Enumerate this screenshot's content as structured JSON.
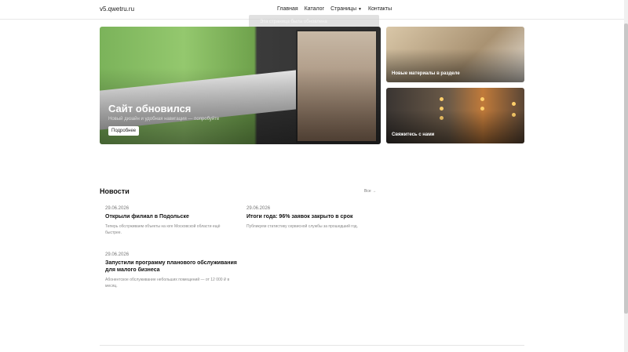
{
  "header": {
    "logo": "v5.qwetru.ru",
    "nav": [
      "Главная",
      "Каталог",
      "Страницы",
      "Контакты"
    ]
  },
  "toast": {
    "text": "Эта страница была обновлена"
  },
  "hero": {
    "title": "Сайт обновился",
    "subtitle": "Новый дизайн и удобная навигация — попробуйте",
    "button": "Подробнее"
  },
  "cards": [
    {
      "label": "Новые материалы в разделе"
    },
    {
      "label": "Свяжитесь с нами"
    }
  ],
  "news": {
    "title": "Новости",
    "all_link": "Все →",
    "items": [
      {
        "date": "29.06.2026",
        "title": "Открыли филиал в Подольске",
        "text": "Теперь обслуживаем объекты на юге Московской области ещё быстрее."
      },
      {
        "date": "29.06.2026",
        "title": "Итоги года: 96% заявок закрыто в срок",
        "text": "Публикуем статистику сервисной службы за прошедший год."
      },
      {
        "date": "29.06.2026",
        "title": "Запустили программу планового обслуживания для малого бизнеса",
        "text": "Абонентское обслуживание небольших помещений — от 12 000 ₽ в месяц."
      }
    ]
  }
}
